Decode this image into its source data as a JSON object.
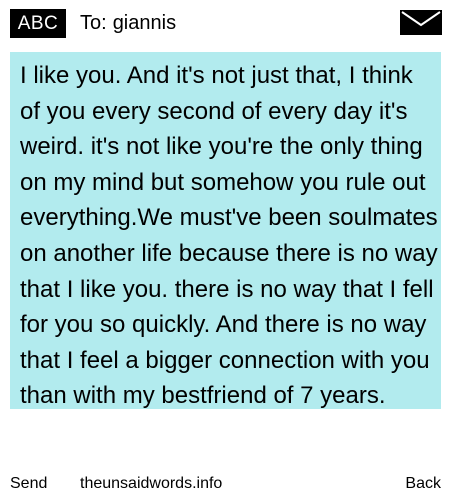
{
  "header": {
    "input_mode": "ABC",
    "to_label": "To:",
    "recipient": "giannis",
    "envelope_icon": "envelope-icon"
  },
  "message": {
    "body": "I like you. And it's not just that, I think of you every second of every day it's weird. it's not like you're the only thing on my mind but somehow you rule out everything.We must've been soulmates on another life because there is no way that I like you. there is no way that I fell for you so quickly. And there is no way that I feel a bigger connection with you than with my bestfriend of 7 years.",
    "highlight_color": "#b2ebee"
  },
  "softkeys": {
    "left": "Send",
    "center": "theunsaidwords.info",
    "right": "Back"
  }
}
